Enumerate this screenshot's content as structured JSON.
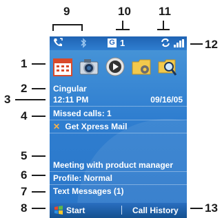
{
  "callouts": [
    "1",
    "2",
    "3",
    "4",
    "5",
    "6",
    "7",
    "8",
    "9",
    "10",
    "11",
    "12",
    "13"
  ],
  "status_bar": {
    "call_icon": "phone-call-icon",
    "bluetooth_icon": "bluetooth-icon",
    "gprs_badge": "G",
    "gprs_count": "1",
    "sync_icon": "sync-icon",
    "signal_icon": "signal-strength-icon"
  },
  "shortcut_icons": [
    "calendar-icon",
    "camera-icon",
    "media-player-icon",
    "settings-folder-icon",
    "search-icon"
  ],
  "home": {
    "operator": "Cingular",
    "time": "12:11 PM",
    "date": "09/16/05",
    "missed_calls": "Missed calls: 1",
    "xpress_mail": "Get Xpress Mail",
    "appointment": "Meeting with product manager",
    "profile": "Profile: Normal",
    "messages": "Text Messages (1)"
  },
  "softkeys": {
    "left": "Start",
    "right": "Call History"
  },
  "colors": {
    "screen_blue": "#2f7ed0",
    "text": "#ffffff",
    "callout": "#1a1a1a"
  }
}
